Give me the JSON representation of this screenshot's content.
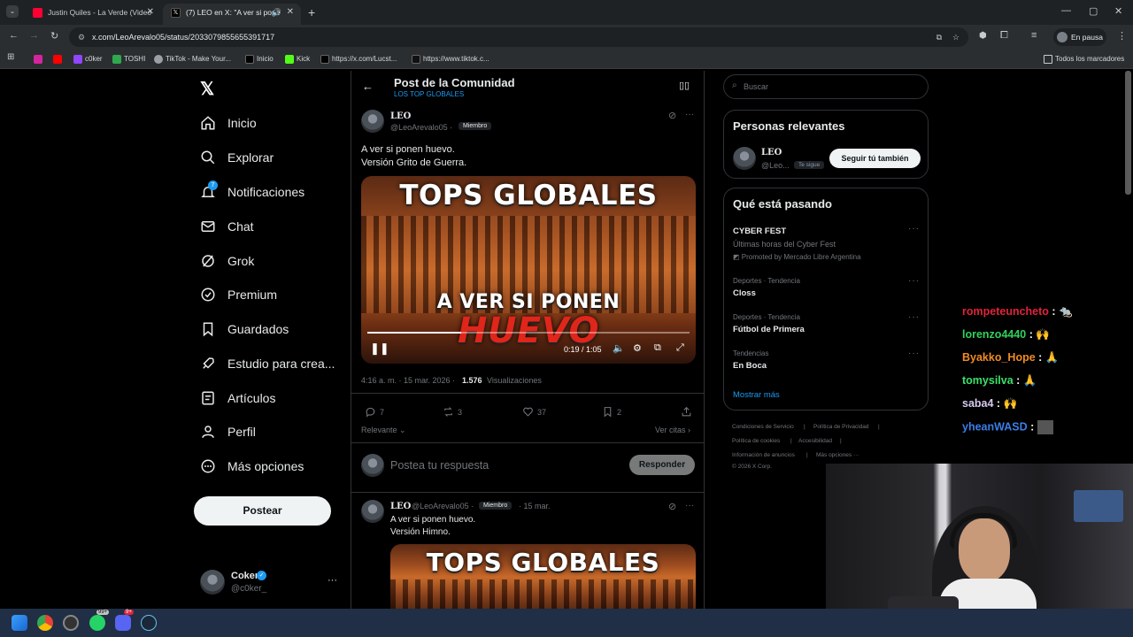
{
  "browser": {
    "tabs": [
      {
        "title": "Justin Quiles - La Verde (Video ",
        "favicon_color": "#ff0033"
      },
      {
        "title": "(7) LEO en X: \"A ver si pone",
        "favicon_color": "#000000"
      }
    ],
    "url": "x.com/LeoArevalo05/status/2033079855655391717",
    "profile_label": "En pausa",
    "bookmarks": [
      {
        "label": "",
        "icon": "instagram-icon",
        "color": "#d6249f"
      },
      {
        "label": "",
        "icon": "youtube-icon",
        "color": "#ff0000"
      },
      {
        "label": "c0ker",
        "icon": "twitch-icon",
        "color": "#9146ff"
      },
      {
        "label": "TOSHI",
        "icon": "plus-icon",
        "color": "#2fa84f"
      },
      {
        "label": "TikTok - Make Your...",
        "icon": "globe-icon",
        "color": "#9aa0a6"
      },
      {
        "label": "Inicio",
        "icon": "x-icon",
        "color": "#000000"
      },
      {
        "label": "Kick",
        "icon": "kick-icon",
        "color": "#53fc18"
      },
      {
        "label": "https://x.com/Lucst...",
        "icon": "x-icon",
        "color": "#000000"
      },
      {
        "label": "https://www.tiktok.c...",
        "icon": "tiktok-icon",
        "color": "#111111"
      }
    ],
    "all_bookmarks": "Todos los marcadores"
  },
  "nav": {
    "items": [
      {
        "label": "Inicio",
        "icon": "home-icon"
      },
      {
        "label": "Explorar",
        "icon": "search-icon"
      },
      {
        "label": "Notificaciones",
        "icon": "bell-icon",
        "badge": "7"
      },
      {
        "label": "Chat",
        "icon": "mail-icon"
      },
      {
        "label": "Grok",
        "icon": "grok-icon"
      },
      {
        "label": "Premium",
        "icon": "verified-icon"
      },
      {
        "label": "Guardados",
        "icon": "bookmark-icon"
      },
      {
        "label": "Estudio para crea...",
        "icon": "rocket-icon"
      },
      {
        "label": "Artículos",
        "icon": "article-icon"
      },
      {
        "label": "Perfil",
        "icon": "person-icon"
      },
      {
        "label": "Más opciones",
        "icon": "more-circle-icon"
      }
    ],
    "post_button": "Postear",
    "account": {
      "name": "Coker",
      "handle": "@c0ker_"
    }
  },
  "header": {
    "title": "Post de la Comunidad",
    "community": "LOS TOP GLOBALES"
  },
  "post": {
    "name": "LEO",
    "handle": "@LeoArevalo05 ·",
    "role": "Miembro",
    "line1": "A ver si ponen huevo.",
    "line2": "Versión Grito de Guerra.",
    "media_title": "TOPS GLOBALES",
    "media_sub1": "A VER SI PONEN",
    "media_sub2": "HUEVO",
    "video_time": "0:19 / 1:05",
    "video_progress": 0.29,
    "timestamp": "4:16 a. m. · 15 mar. 2026 ·",
    "views": "1.576",
    "views_label": "Visualizaciones",
    "replies": "7",
    "reposts": "3",
    "likes": "37",
    "bookmarks": "2",
    "sort_label": "Relevante",
    "quotes_label": "Ver citas",
    "reply_placeholder": "Postea tu respuesta",
    "reply_button": "Responder"
  },
  "reply": {
    "name": "LEO",
    "handle": "@LeoArevalo05 ·",
    "role": "Miembro",
    "date": "· 15 mar.",
    "line1": "A ver si ponen huevo.",
    "line2": "Versión Himno.",
    "media_title": "TOPS GLOBALES"
  },
  "sidebar": {
    "search_placeholder": "Buscar",
    "relevant_title": "Personas relevantes",
    "person": {
      "name": "LEO",
      "handle": "@Leo...",
      "follows_you": "Te sigue",
      "follow_button": "Seguir tú también"
    },
    "happening_title": "Qué está pasando",
    "trends": [
      {
        "meta": "",
        "title": "CYBER FEST",
        "sub": "Últimas horas del Cyber Fest",
        "promo": "Promoted by Mercado Libre Argentina"
      },
      {
        "meta": "Deportes · Tendencia",
        "title": "Closs"
      },
      {
        "meta": "Deportes · Tendencia",
        "title": "Fútbol de Primera"
      },
      {
        "meta": "Tendencias",
        "title": "En Boca"
      }
    ],
    "show_more": "Mostrar más",
    "footer": [
      "Condiciones de Servicio",
      "Política de Privacidad",
      "Política de cookies",
      "Accesibilidad",
      "Información de anuncios",
      "Más opciones ···",
      "© 2026 X Corp."
    ]
  },
  "stream_chat": [
    {
      "user": "rompeteuncheto",
      "color": "#e0243a"
    },
    {
      "user": "lorenzo4440",
      "color": "#2fd15a"
    },
    {
      "user": "Byakko_Hope",
      "color": "#f08a24"
    },
    {
      "user": "tomysilva",
      "color": "#39e06a"
    },
    {
      "user": "saba4",
      "color": "#d7c9f0"
    },
    {
      "user": "yheanWASD",
      "color": "#3b7ee8"
    }
  ],
  "taskbar": {
    "whatsapp_badge": "99+",
    "discord_badge": "9+"
  }
}
